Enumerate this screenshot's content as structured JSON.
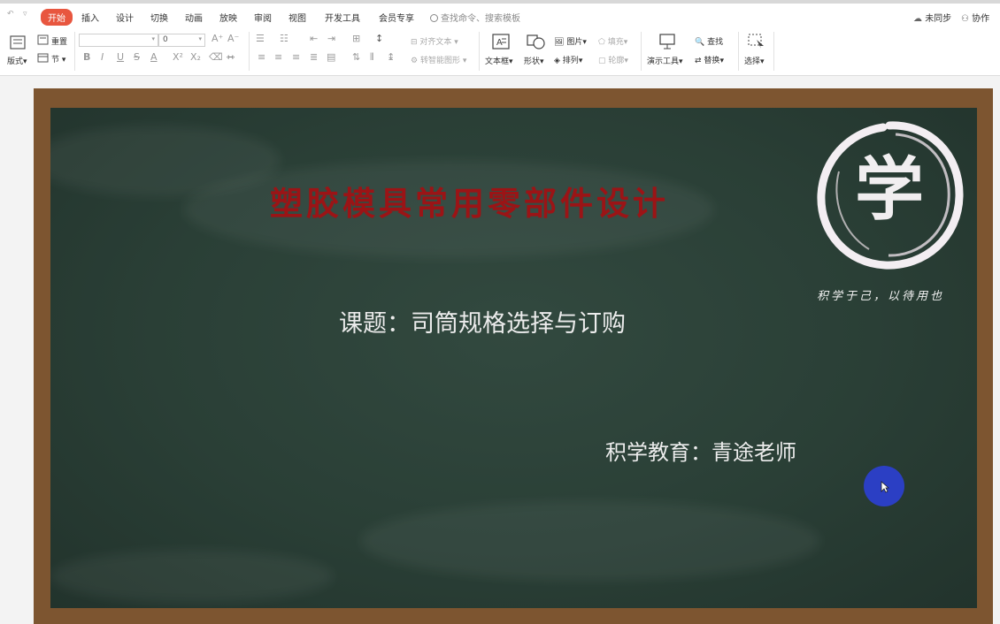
{
  "menubar": {
    "tabs": [
      {
        "label": "开始",
        "active": true
      },
      {
        "label": "插入"
      },
      {
        "label": "设计"
      },
      {
        "label": "切换"
      },
      {
        "label": "动画"
      },
      {
        "label": "放映"
      },
      {
        "label": "审阅"
      },
      {
        "label": "视图"
      },
      {
        "label": "开发工具"
      },
      {
        "label": "会员专享"
      }
    ],
    "search_text": "查找命令、搜索模板",
    "sync_label": "未同步",
    "collab_label": "协作"
  },
  "toolbar": {
    "layout_label": "版式",
    "reset_label": "重置",
    "section_label": "节",
    "font_size_value": "0",
    "align_text_label": "对齐文本",
    "convert_smartart_label": "转智能图形",
    "textbox_label": "文本框",
    "shape_label": "形状",
    "picture_label": "图片",
    "arrange_label": "排列",
    "fill_label": "填充",
    "outline_label": "轮廓",
    "present_tools_label": "演示工具",
    "find_label": "查找",
    "replace_label": "替换",
    "select_label": "选择",
    "font_format_glyphs": [
      "B",
      "I",
      "U",
      "S",
      "A",
      "X²",
      "X₂"
    ],
    "font_grow": "A⁺",
    "font_shrink": "A⁻"
  },
  "slide": {
    "title": "塑胶模具常用零部件设计",
    "subtitle": "课题：司筒规格选择与订购",
    "author": "积学教育：青途老师",
    "logo_char": "学",
    "logo_motto": "积学于己，以待用也",
    "title_color": "#9b1416",
    "board_color": "#2d433a",
    "frame_color": "#7d5530"
  },
  "colors": {
    "active_tab": "#e8563f",
    "cursor": "#2b3fc4"
  }
}
